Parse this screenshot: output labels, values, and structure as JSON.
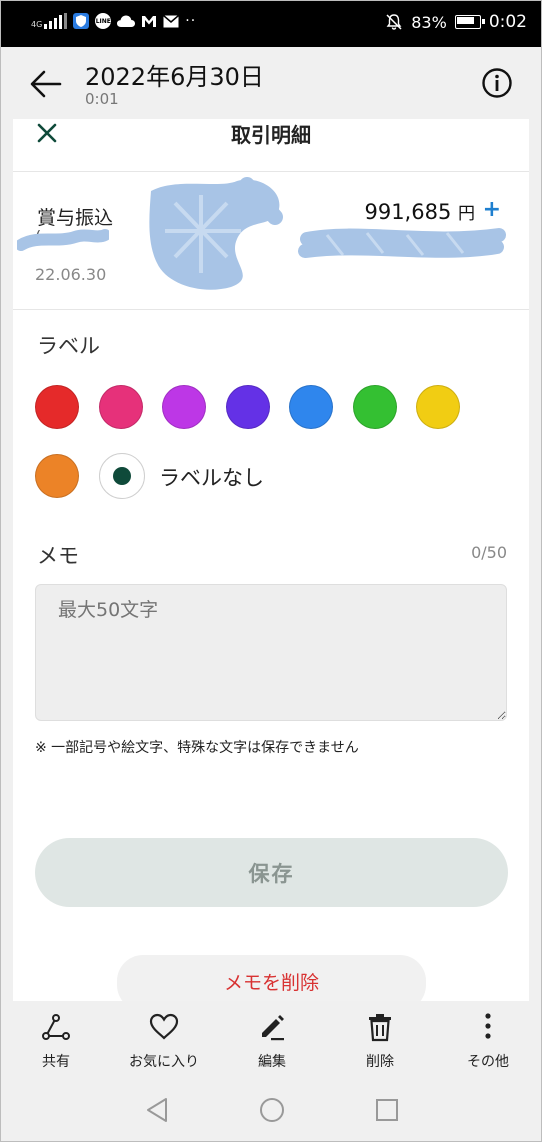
{
  "status_bar": {
    "network": "4G",
    "battery": "83%",
    "time": "0:02",
    "icons": [
      "signal-icon",
      "shield-icon",
      "line-icon",
      "cloud-icon",
      "gmail-icon",
      "mail-icon",
      "more-icon",
      "mute-icon",
      "battery-icon"
    ]
  },
  "header": {
    "date": "2022年6月30日",
    "time": "0:01"
  },
  "sheet": {
    "title": "取引明細"
  },
  "transaction": {
    "name": "賞与振込",
    "sub": "(",
    "date": "22.06.30",
    "amount": "991,685",
    "currency": "円",
    "add": "+"
  },
  "labels": {
    "heading": "ラベル",
    "colors": [
      "#e52a2a",
      "#e6317a",
      "#bd37e6",
      "#6431e6",
      "#2f86ed",
      "#34c032",
      "#f1cd13",
      "#ec8327"
    ],
    "none_label": "ラベルなし"
  },
  "memo": {
    "heading": "メモ",
    "count": "0/50",
    "placeholder": "最大50文字",
    "value": "",
    "note": "※ 一部記号や絵文字、特殊な文字は保存できません"
  },
  "buttons": {
    "save": "保存",
    "delete_memo": "メモを削除"
  },
  "bottom_nav": [
    {
      "label": "共有",
      "icon": "share-icon"
    },
    {
      "label": "お気に入り",
      "icon": "heart-icon"
    },
    {
      "label": "編集",
      "icon": "pencil-icon"
    },
    {
      "label": "削除",
      "icon": "trash-icon"
    },
    {
      "label": "その他",
      "icon": "more-vertical-icon"
    }
  ]
}
